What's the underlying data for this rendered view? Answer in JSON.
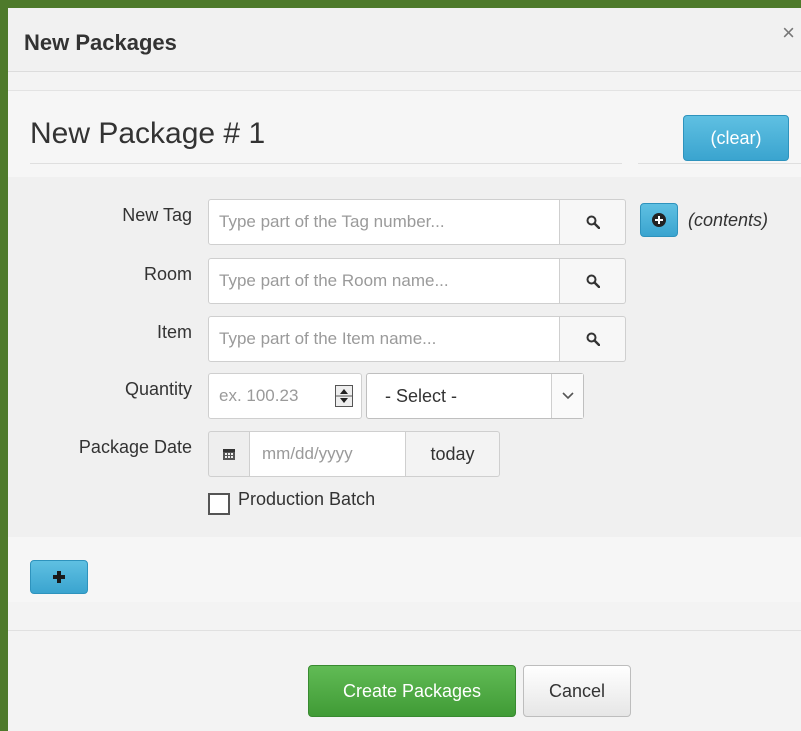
{
  "dialog": {
    "title": "New Packages",
    "close_glyph": "×"
  },
  "package": {
    "heading": "New Package # 1",
    "clear_label": "(clear)",
    "contents_label": "(contents)"
  },
  "form": {
    "new_tag": {
      "label": "New Tag",
      "placeholder": "Type part of the Tag number..."
    },
    "room": {
      "label": "Room",
      "placeholder": "Type part of the Room name..."
    },
    "item": {
      "label": "Item",
      "placeholder": "Type part of the Item name..."
    },
    "quantity": {
      "label": "Quantity",
      "placeholder": "ex. 100.23",
      "unit_selected": "- Select -"
    },
    "package_date": {
      "label": "Package Date",
      "placeholder": "mm/dd/yyyy",
      "today_label": "today"
    },
    "production_batch": {
      "label": "Production Batch",
      "checked": false
    }
  },
  "footer": {
    "create_label": "Create Packages",
    "cancel_label": "Cancel"
  },
  "icons": {
    "search": "search-icon",
    "calendar": "calendar-icon",
    "plus_circle": "plus-circle-icon",
    "plus": "plus-icon",
    "chevron_down": "chevron-down-icon"
  },
  "colors": {
    "primary_blue": "#3aa4cf",
    "success_green": "#409b36",
    "frame_green": "#4e7a2b"
  }
}
